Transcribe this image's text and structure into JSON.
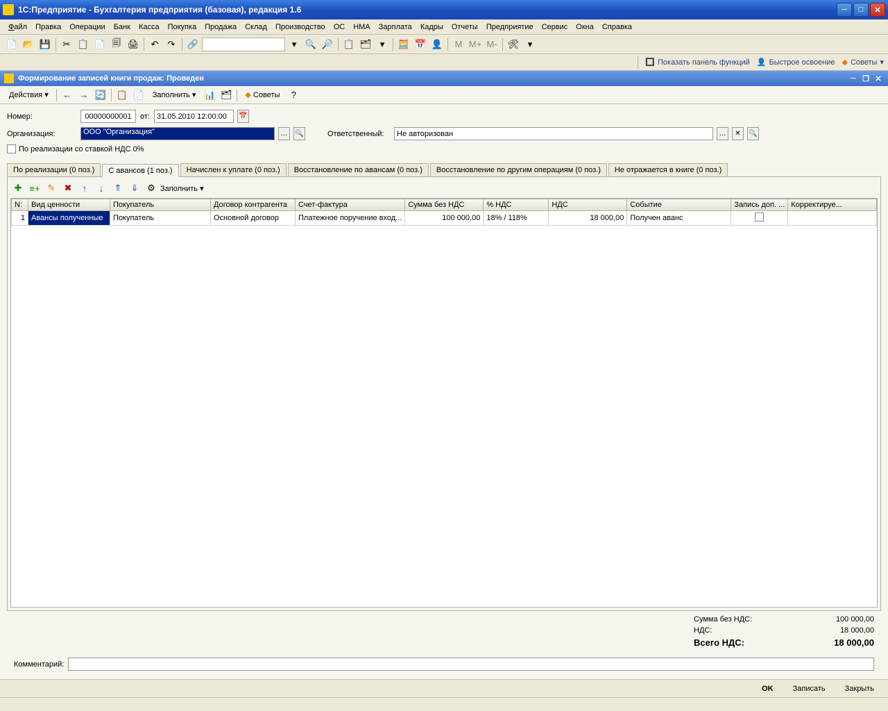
{
  "window": {
    "title": "1С:Предприятие - Бухгалтерия предприятия (базовая), редакция 1.6"
  },
  "menu": {
    "file": "Файл",
    "edit": "Правка",
    "operations": "Операции",
    "bank": "Банк",
    "cash": "Касса",
    "purchase": "Покупка",
    "sale": "Продажа",
    "stock": "Склад",
    "production": "Производство",
    "os": "ОС",
    "nma": "НМА",
    "salary": "Зарплата",
    "staff": "Кадры",
    "reports": "Отчеты",
    "enterprise": "Предприятие",
    "service": "Сервис",
    "windows": "Окна",
    "help": "Справка"
  },
  "auxbar": {
    "panel": "Показать панель функций",
    "quick": "Быстрое освоение",
    "tips": "Советы"
  },
  "doc": {
    "title": "Формирование записей книги продаж: Проведен",
    "actions": "Действия",
    "fill": "Заполнить",
    "tips": "Советы"
  },
  "form": {
    "number_label": "Номер:",
    "number": "00000000001",
    "from_label": "от:",
    "date": "31.05.2010 12:00:00",
    "org_label": "Организация:",
    "org": "ООО \"Организация\"",
    "resp_label": "Ответственный:",
    "resp": "Не авторизован",
    "zero_vat": "По реализации со ставкой НДС 0%"
  },
  "tabs": {
    "t0": "По реализации (0 поз.)",
    "t1": "С авансов (1 поз.)",
    "t2": "Начислен к уплате (0 поз.)",
    "t3": "Восстановление по авансам (0 поз.)",
    "t4": "Восстановление по другим операциям (0 поз.)",
    "t5": "Не отражается в книге (0 поз.)",
    "fill": "Заполнить"
  },
  "grid": {
    "h_n": "N:",
    "h_type": "Вид ценности",
    "h_buyer": "Покупатель",
    "h_contract": "Договор контрагента",
    "h_invoice": "Счет-фактура",
    "h_sum": "Сумма без НДС",
    "h_pct": "% НДС",
    "h_vat": "НДС",
    "h_event": "Событие",
    "h_addrec": "Запись доп. ...",
    "h_corr": "Корректируе...",
    "r0_n": "1",
    "r0_type": "Авансы полученные",
    "r0_buyer": "Покупатель",
    "r0_contract": "Основной договор",
    "r0_invoice": "Платежное поручение вход...",
    "r0_sum": "100 000,00",
    "r0_pct": "18% / 118%",
    "r0_vat": "18 000,00",
    "r0_event": "Получен аванс"
  },
  "totals": {
    "sum_label": "Сумма без НДС:",
    "sum": "100 000,00",
    "vat_label": "НДС:",
    "vat": "18 000,00",
    "total_label": "Всего НДС:",
    "total": "18 000,00"
  },
  "comment": {
    "label": "Комментарий:",
    "value": ""
  },
  "buttons": {
    "ok": "OK",
    "save": "Записать",
    "close": "Закрыть"
  },
  "m_tooltip": {
    "m": "M",
    "mplus": "M+",
    "mminus": "M-"
  }
}
